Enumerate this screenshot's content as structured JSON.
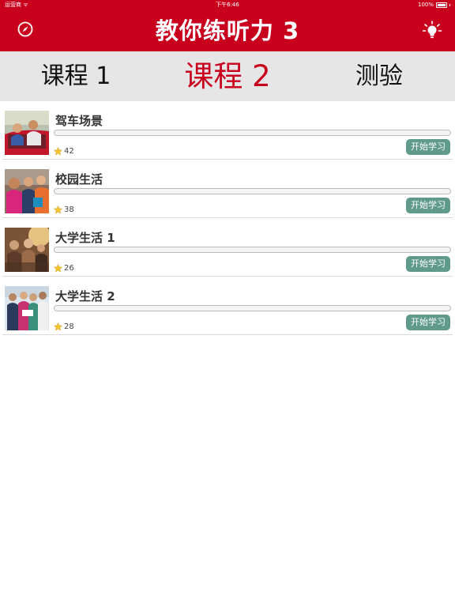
{
  "status_bar": {
    "carrier": "运营商 ᯤ",
    "time": "下午6:46",
    "battery": "100%"
  },
  "header": {
    "title": "教你练听力 3",
    "left_icon": "compass-icon",
    "right_icon": "lightbulb-icon",
    "color": "#c8001e"
  },
  "tabs": [
    {
      "label": "课程 1",
      "active": false
    },
    {
      "label": "课程 2",
      "active": true
    },
    {
      "label": "测验",
      "active": false
    }
  ],
  "lessons": [
    {
      "title": "驾车场景",
      "stars": "42",
      "progress": 0,
      "button": "开始学习",
      "thumb": "driving-scene"
    },
    {
      "title": "校园生活",
      "stars": "38",
      "progress": 0,
      "button": "开始学习",
      "thumb": "campus-life"
    },
    {
      "title": "大学生活 1",
      "stars": "26",
      "progress": 0,
      "button": "开始学习",
      "thumb": "college-life-1"
    },
    {
      "title": "大学生活 2",
      "stars": "28",
      "progress": 0,
      "button": "开始学习",
      "thumb": "college-life-2"
    }
  ],
  "colors": {
    "accent": "#c8001e",
    "button": "#5f9a8a",
    "tab_bar": "#e6e6e6"
  }
}
